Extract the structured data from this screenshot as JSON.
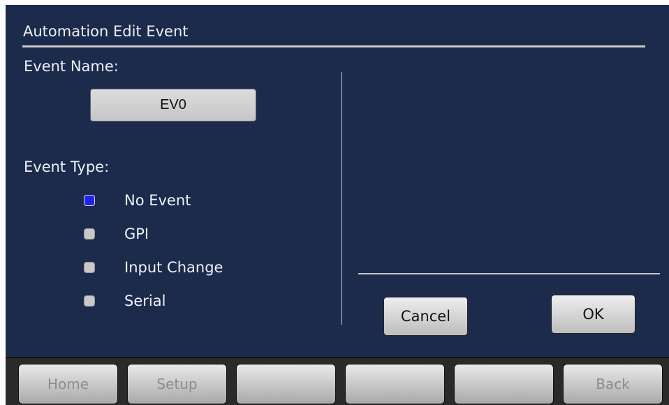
{
  "dialog": {
    "title": "Automation Edit Event",
    "event_name_label": "Event Name:",
    "event_name_value": "EV0",
    "event_type_label": "Event Type:",
    "event_types": [
      {
        "label": "No Event",
        "selected": true
      },
      {
        "label": "GPI",
        "selected": false
      },
      {
        "label": "Input Change",
        "selected": false
      },
      {
        "label": "Serial",
        "selected": false
      }
    ],
    "cancel_label": "Cancel",
    "ok_label": "OK"
  },
  "bottom_nav": {
    "buttons": [
      {
        "label": "Home",
        "enabled": false
      },
      {
        "label": "Setup",
        "enabled": false
      },
      {
        "label": "",
        "enabled": false
      },
      {
        "label": "",
        "enabled": false
      },
      {
        "label": "",
        "enabled": false
      },
      {
        "label": "Back",
        "enabled": false
      }
    ]
  },
  "colors": {
    "background": "#1c2b4c",
    "selected_radio": "#1f22e8",
    "unselected_radio": "#c9c9c9",
    "text": "#eef1f6"
  }
}
